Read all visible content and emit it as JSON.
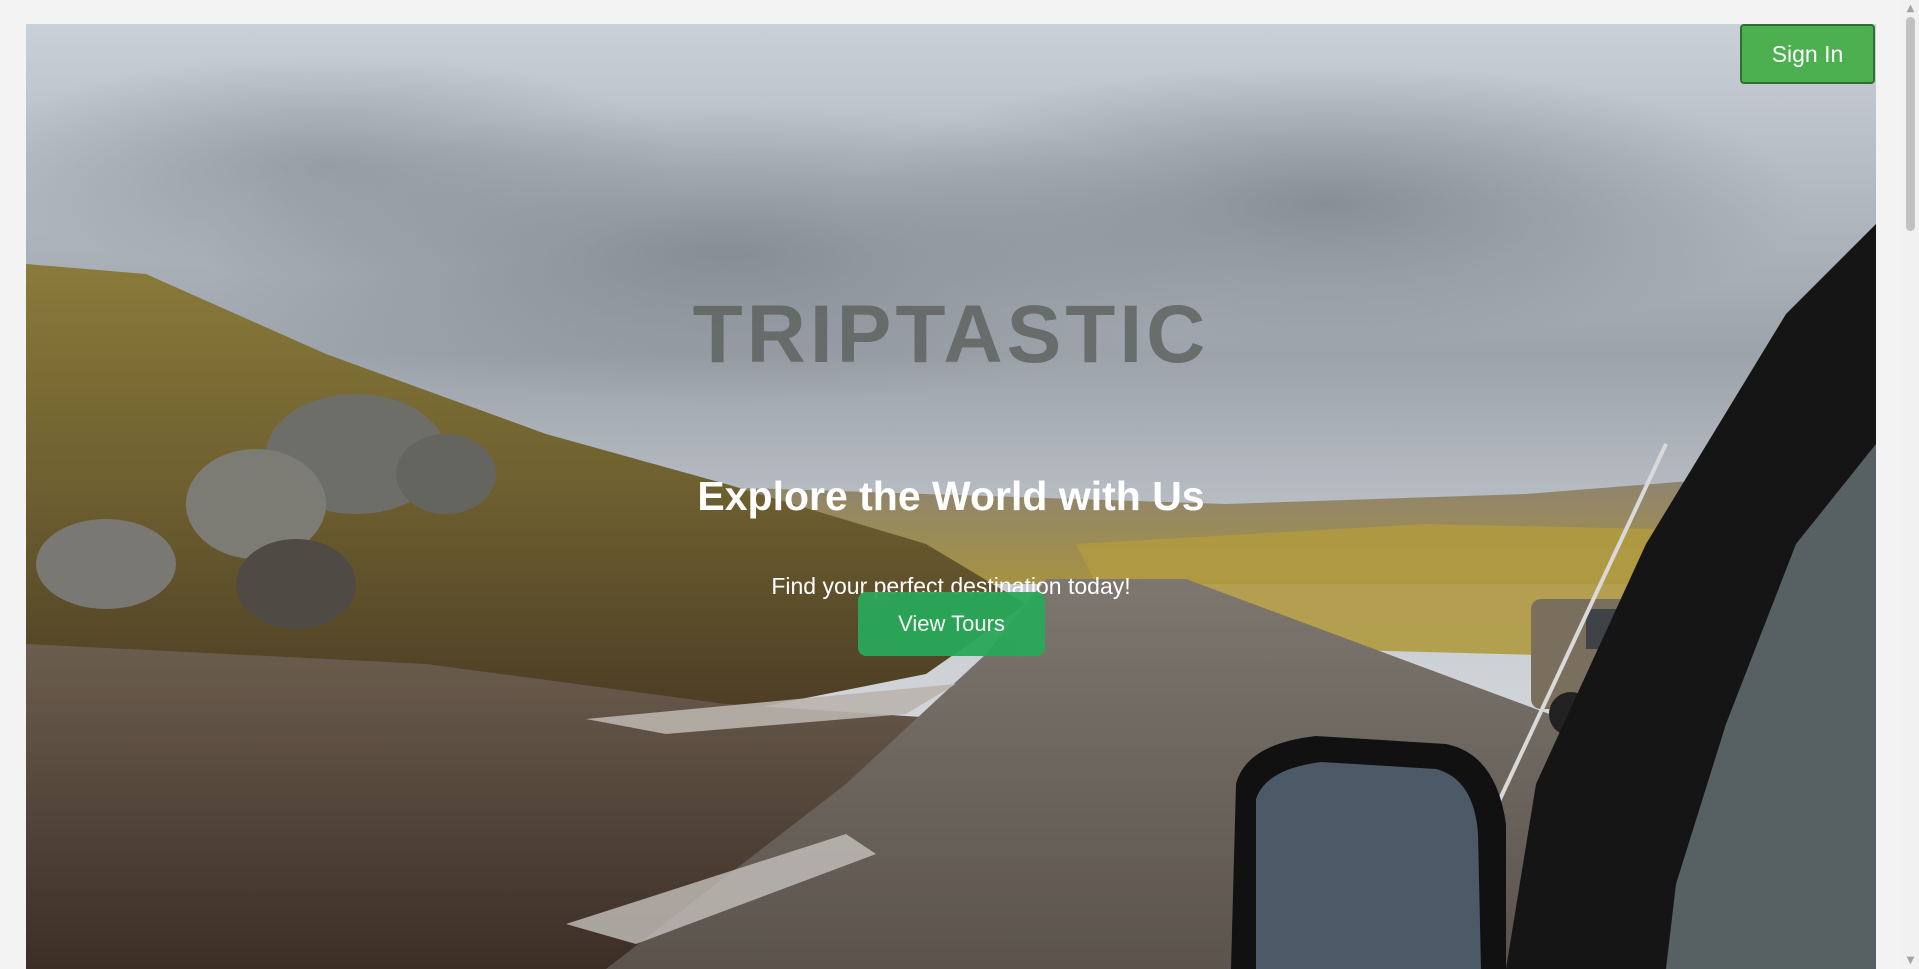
{
  "header": {
    "sign_in_label": "Sign In"
  },
  "hero": {
    "brand": "TRIPTASTIC",
    "tagline": "Explore the World with Us",
    "subtitle": "Find your perfect destination today!",
    "cta_label": "View Tours",
    "background": "mountain gravel road photo viewed from vehicle window"
  },
  "scrollbar": {
    "up_icon": "▲",
    "down_icon": "▼"
  },
  "colors": {
    "cta_green": "#29a85a",
    "sign_in_green": "#4caf50",
    "page_background": "#f3f3f3"
  }
}
